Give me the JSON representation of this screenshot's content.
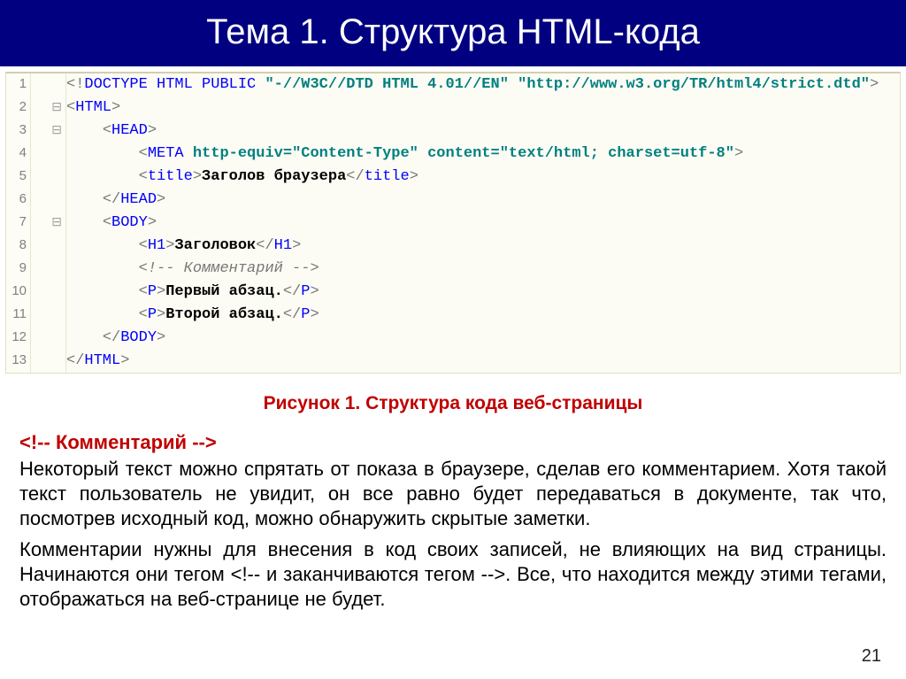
{
  "header": {
    "title": "Тема 1. Структура HTML-кода"
  },
  "code": {
    "lines": [
      {
        "n": "1",
        "fold": "",
        "html": "<span class='tk-punc'>&lt;!</span><span class='tk-kw'>DOCTYPE</span> <span class='tk-kw'>HTML</span> <span class='tk-kw'>PUBLIC</span> <span class='tk-str'>\"-//W3C//DTD HTML 4.01//EN\"</span> <span class='tk-str'>\"http://www.w3.org/TR/html4/strict.dtd\"</span><span class='tk-punc'>&gt;</span>"
      },
      {
        "n": "2",
        "fold": "⊟",
        "html": "<span class='tk-punc'>&lt;</span><span class='tk-tag'>HTML</span><span class='tk-punc'>&gt;</span>"
      },
      {
        "n": "3",
        "fold": "⊟",
        "html": "    <span class='tk-punc'>&lt;</span><span class='tk-tag'>HEAD</span><span class='tk-punc'>&gt;</span>"
      },
      {
        "n": "4",
        "fold": "",
        "html": "        <span class='tk-punc'>&lt;</span><span class='tk-tag'>META</span> <span class='tk-attr'>http-equiv=</span><span class='tk-str'>\"Content-Type\"</span> <span class='tk-attr'>content=</span><span class='tk-str'>\"text/html; charset=utf-8\"</span><span class='tk-punc'>&gt;</span>"
      },
      {
        "n": "5",
        "fold": "",
        "html": "        <span class='tk-punc'>&lt;</span><span class='tk-tag'>title</span><span class='tk-punc'>&gt;</span><span class='tk-txt'>Заголов браузера</span><span class='tk-punc'>&lt;/</span><span class='tk-tag'>title</span><span class='tk-punc'>&gt;</span>"
      },
      {
        "n": "6",
        "fold": "",
        "html": "    <span class='tk-punc'>&lt;/</span><span class='tk-tag'>HEAD</span><span class='tk-punc'>&gt;</span>"
      },
      {
        "n": "7",
        "fold": "⊟",
        "html": "    <span class='tk-punc'>&lt;</span><span class='tk-tag'>BODY</span><span class='tk-punc'>&gt;</span>"
      },
      {
        "n": "8",
        "fold": "",
        "html": "        <span class='tk-punc'>&lt;</span><span class='tk-tag'>H1</span><span class='tk-punc'>&gt;</span><span class='tk-txt'>Заголовок</span><span class='tk-punc'>&lt;/</span><span class='tk-tag'>H1</span><span class='tk-punc'>&gt;</span>"
      },
      {
        "n": "9",
        "fold": "",
        "html": "        <span class='tk-cmt'>&lt;!-- Комментарий --&gt;</span>"
      },
      {
        "n": "10",
        "fold": "",
        "html": "        <span class='tk-punc'>&lt;</span><span class='tk-tag'>P</span><span class='tk-punc'>&gt;</span><span class='tk-txt'>Первый абзац.</span><span class='tk-punc'>&lt;/</span><span class='tk-tag'>P</span><span class='tk-punc'>&gt;</span>"
      },
      {
        "n": "11",
        "fold": "",
        "html": "        <span class='tk-punc'>&lt;</span><span class='tk-tag'>P</span><span class='tk-punc'>&gt;</span><span class='tk-txt'>Второй абзац.</span><span class='tk-punc'>&lt;/</span><span class='tk-tag'>P</span><span class='tk-punc'>&gt;</span>"
      },
      {
        "n": "12",
        "fold": "",
        "html": "    <span class='tk-punc'>&lt;/</span><span class='tk-tag'>BODY</span><span class='tk-punc'>&gt;</span>"
      },
      {
        "n": "13",
        "fold": "",
        "html": "<span class='tk-punc'>&lt;/</span><span class='tk-tag'>HTML</span><span class='tk-punc'>&gt;</span>"
      }
    ]
  },
  "caption": "Рисунок 1. Структура кода веб-страницы",
  "body": {
    "comment_sample": "<!-- Комментарий -->",
    "p1": "Некоторый текст можно спрятать от показа в браузере, сделав его комментарием. Хотя такой текст пользователь не увидит, он все равно будет передаваться в документе, так что, посмотрев исходный код, можно обнаружить скрытые заметки.",
    "p2": "Комментарии нужны для внесения в код своих записей, не влияющих на вид страницы. Начинаются они тегом <!-- и заканчиваются тегом -->. Все, что находится между этими тегами, отображаться на веб-странице не будет."
  },
  "page_number": "21"
}
